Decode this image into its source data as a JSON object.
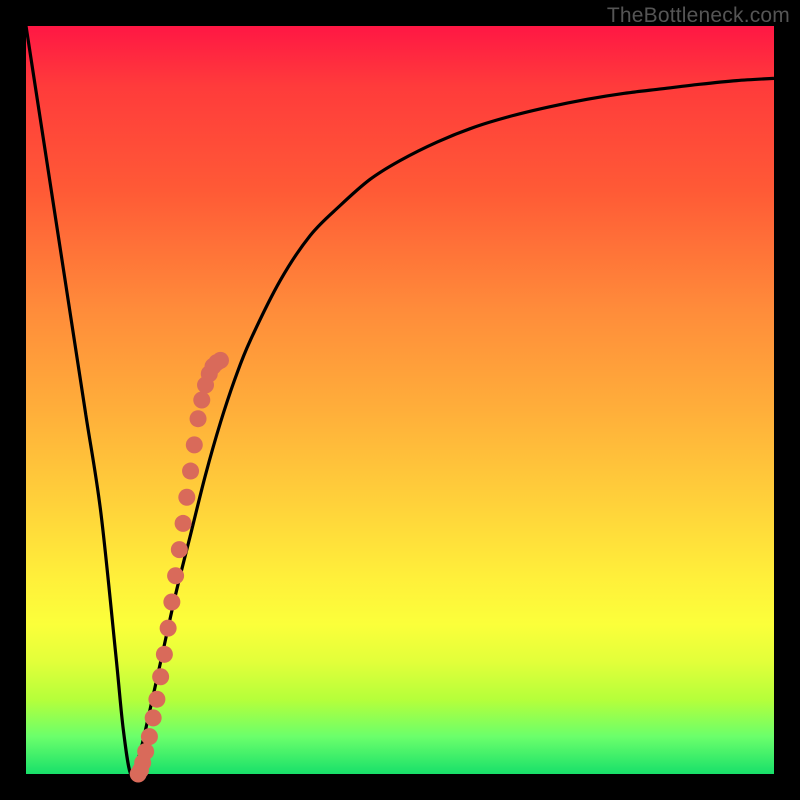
{
  "watermark": "TheBottleneck.com",
  "chart_data": {
    "type": "line",
    "title": "",
    "xlabel": "",
    "ylabel": "",
    "xlim": [
      0,
      100
    ],
    "ylim": [
      0,
      100
    ],
    "series": [
      {
        "name": "bottleneck-curve",
        "x": [
          0,
          2,
          4,
          6,
          8,
          10,
          12,
          13,
          14,
          15,
          16,
          18,
          20,
          22,
          24,
          26,
          28,
          30,
          34,
          38,
          42,
          46,
          50,
          55,
          60,
          65,
          70,
          75,
          80,
          85,
          90,
          95,
          100
        ],
        "y": [
          100,
          87,
          74,
          61,
          48,
          35,
          16,
          6,
          0,
          2,
          6,
          15,
          24,
          32,
          40,
          47,
          53,
          58,
          66,
          72,
          76,
          79.5,
          82,
          84.5,
          86.5,
          88,
          89.2,
          90.2,
          91,
          91.6,
          92.2,
          92.7,
          93
        ]
      }
    ],
    "highlight": {
      "name": "highlight-dots",
      "color": "#d96a5a",
      "x": [
        15,
        15.3,
        15.6,
        16,
        16.5,
        17,
        17.5,
        18,
        18.5,
        19,
        19.5,
        20,
        20.5,
        21,
        21.5,
        22,
        22.5,
        23,
        23.5,
        24,
        24.5,
        25,
        25.5,
        26
      ],
      "y": [
        0,
        0.5,
        1.5,
        3,
        5,
        7.5,
        10,
        13,
        16,
        19.5,
        23,
        26.5,
        30,
        33.5,
        37,
        40.5,
        44,
        47.5,
        50,
        52,
        53.5,
        54.5,
        55,
        55.3
      ]
    },
    "gradient_stops": [
      {
        "pos": 0,
        "color": "#ff1744"
      },
      {
        "pos": 8,
        "color": "#ff3b3b"
      },
      {
        "pos": 22,
        "color": "#ff5a36"
      },
      {
        "pos": 38,
        "color": "#ff8c3a"
      },
      {
        "pos": 52,
        "color": "#ffb03a"
      },
      {
        "pos": 64,
        "color": "#ffd23a"
      },
      {
        "pos": 74,
        "color": "#fff03a"
      },
      {
        "pos": 80,
        "color": "#fbff3a"
      },
      {
        "pos": 85,
        "color": "#e2ff3a"
      },
      {
        "pos": 90,
        "color": "#b6ff3a"
      },
      {
        "pos": 95,
        "color": "#6bff6b"
      },
      {
        "pos": 100,
        "color": "#18e06a"
      }
    ]
  }
}
